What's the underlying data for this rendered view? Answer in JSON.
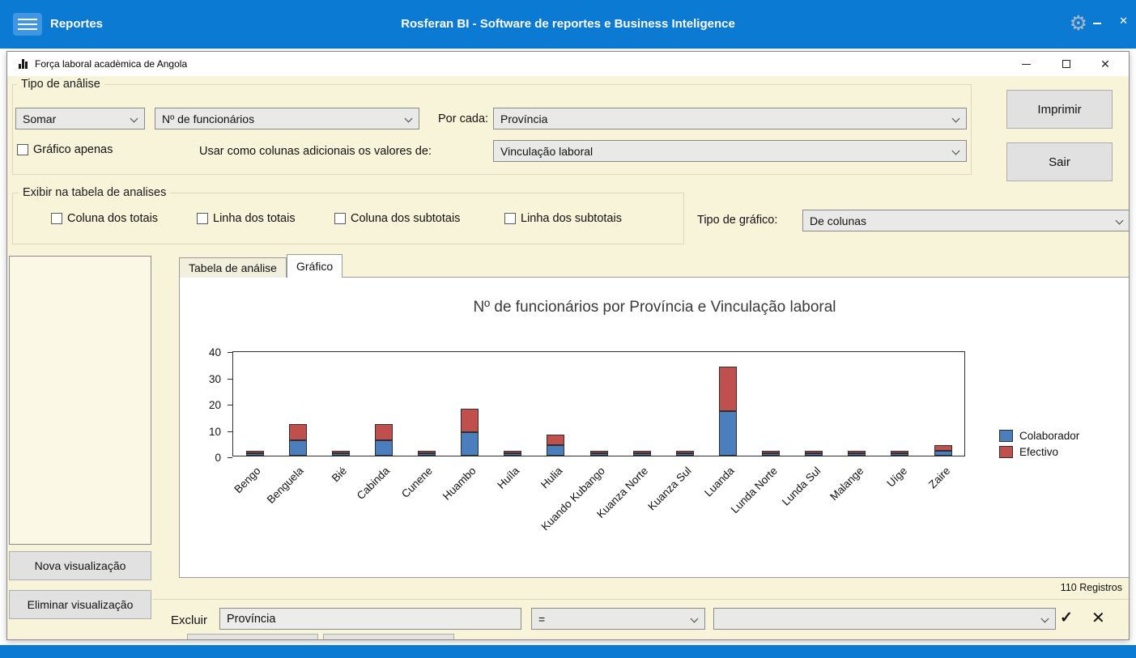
{
  "colors": {
    "titlebar_blue": "#0b7ad3",
    "content_cream": "#f7f4da",
    "bar_blue": "#4a7ebc",
    "bar_red": "#c0504d"
  },
  "icons": {
    "gear": "⚙",
    "close": "✕",
    "confirm": "✓",
    "cancel": "✕"
  },
  "titlebar": {
    "menu_label": "Reportes",
    "app_title": "Rosferan BI - Software de reportes e Business Inteligence"
  },
  "window": {
    "title": "Força laboral acadèmica de Angola"
  },
  "analysis": {
    "group_title": "Tipo de anâlise",
    "operation_value": "Somar",
    "measure_value": "Nº de funcionários",
    "per_label": "Por cada:",
    "per_value": "Província",
    "chart_only_label": "Gráfico apenas",
    "extra_columns_label": "Usar como colunas adicionais os valores de:",
    "extra_columns_value": "Vinculação laboral"
  },
  "buttons": {
    "print": "Imprimir",
    "exit": "Sair",
    "new_view": "Nova visualização",
    "delete_view": "Eliminar visualização"
  },
  "table_options": {
    "group_title": "Exibir na tabela de analises",
    "checkboxes": [
      "Coluna dos totais",
      "Linha dos totais",
      "Coluna dos subtotais",
      "Linha dos subtotais"
    ],
    "chart_type_label": "Tipo de gráfico:",
    "chart_type_value": "De colunas"
  },
  "tabs": {
    "table": "Tabela de análise",
    "chart": "Gráfico"
  },
  "chart_data": {
    "type": "bar",
    "stacked": true,
    "title": "Nº de funcionários por Província e Vinculação laboral",
    "categories": [
      "Bengo",
      "Benguela",
      "Bié",
      "Cabinda",
      "Cunene",
      "Huambo",
      "Huíla",
      "Hulia",
      "Kuando Kubango",
      "Kuanza Norte",
      "Kuanza Sul",
      "Luanda",
      "Lunda Norte",
      "Lunda Sul",
      "Malange",
      "Uíge",
      "Zaire"
    ],
    "series": [
      {
        "name": "Colaborador",
        "color": "#4a7ebc",
        "values": [
          1,
          6,
          1,
          6,
          1,
          9,
          1,
          4,
          1,
          1,
          1,
          17,
          1,
          1,
          1,
          1,
          2
        ]
      },
      {
        "name": "Efectivo",
        "color": "#c0504d",
        "values": [
          1,
          6,
          1,
          6,
          1,
          9,
          1,
          4,
          1,
          1,
          1,
          17,
          1,
          1,
          1,
          1,
          2
        ]
      }
    ],
    "ylim": [
      0,
      40
    ],
    "yticks": [
      0,
      10,
      20,
      30,
      40
    ],
    "legend_position": "right",
    "grid": false
  },
  "status": {
    "records": "110 Registros"
  },
  "filter": {
    "label": "Excluir",
    "field_value": "Província",
    "operator_value": "=",
    "value_value": ""
  }
}
